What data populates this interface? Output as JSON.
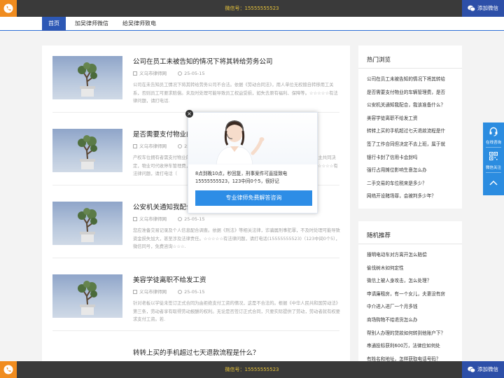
{
  "topbar": {
    "wechat_text": "微信号：15555555523",
    "add_wechat": "添加微信"
  },
  "bottombar": {
    "wechat_text": "微信号：15555555523",
    "add_wechat": "添加微信"
  },
  "nav": {
    "items": [
      "首页",
      "加吴律师微信",
      "给吴律师致电"
    ]
  },
  "articles": [
    {
      "title": "公司在员工未被告知的情况下将其转给劳务公司",
      "source": "义乌市律师网",
      "date": "25-05-15",
      "desc": "公司在未告知员工情况下将其转给劳务公司不合法。依据《劳动合同法》，用人单位无权擅自转移用工关系，否则员工可要求赔偿。未及时处理可能导致员工权益受损，如失去原有福利、保障等。☆☆☆☆☆有法律问题，请打电话."
    },
    {
      "title": "是否需要支付物业的车辆管理费，是否",
      "source": "义乌市律师网",
      "date": "25-05-15",
      "desc": "产权车位拥有者需支付物业的车辆管理费，但是否合理需看物业提供的服务。物业服务费用由业主共同决定，物业可代收停车管理费，应当服务合同约定。未约定，可能需要协商，依法定标准使用。☆☆☆☆☆有法律问题，请打电话（"
    },
    {
      "title": "公安机关通知我配合，我该准备什么？",
      "source": "义乌市律师网",
      "date": "25-05-15",
      "desc": "您应准备交易记录及个人信息配合调查。依据《刑法》等相关法律，诈骗属刑事犯罪，不及时处理可能导致资金损失加大，甚至涉及法律责任。☆☆☆☆☆有法律问题，请打电话(15555555523)（123中间0个5），微信同号，免费咨询☆☆☆."
    },
    {
      "title": "美容学徒离职不给发工资",
      "source": "义乌市律师网",
      "date": "25-05-15",
      "desc": "针对老板以学徒未签订正式合同为由拒绝支付工资的情况，这是不合法的。根据《中华人民共和国劳动法》第三条，劳动者享有取得劳动报酬的权利。无论是否签订正式合同，只要实际提供了劳动，劳动者就有权要求支付工资。若."
    },
    {
      "title": "转转上买的手机超过七天退款流程是什么？",
      "source": "",
      "date": "",
      "desc": ""
    }
  ],
  "sidebar_hot": {
    "title": "热门浏览",
    "items": [
      "公司在员工未被告知的情况下将其转给",
      "是否需要支付物业的车辆管理费，是否",
      "公安机关通知我配合，我该准备什么？",
      "美容学徒离职不给发工资",
      "转转上买的手机超过七天退款流程是什",
      "签了工作合同但决定不去上班，属于就",
      "银行卡封了信用卡会封吗",
      "强行占用摊位影响生意怎么办",
      "二手交易的车位税来是多少？",
      "网络开设赌场罪，会被判多少年？"
    ]
  },
  "sidebar_random": {
    "title": "随机推荐",
    "items": [
      "撞明电动车对方离开怎么赔偿",
      "偷伐树木如何定性",
      "微信上被人身攻击，怎么处理？",
      "申请廉租房，有一个女儿，夫妻没有房",
      "中介进入进厂一个月多钱",
      "商场购物不给退货怎么办",
      "帮别人办理的贷款如何转到他账户下？",
      "串通投标获利600万，法律应如何处",
      "有姓名和地址，怎样获取电话号码？"
    ]
  },
  "float_bar": {
    "consult": "在线咨询",
    "follow": "微信关注"
  },
  "popup": {
    "message": "8点到晚10点，秒回复，刑事案件可直接致电15555555523，123中间0个5，很好记",
    "cta": "专业律师免费解答咨询",
    "close": "×"
  },
  "colors": {
    "accent": "#2d58b5",
    "orange": "#f08c1f",
    "float_blue": "#2b8ce0"
  }
}
